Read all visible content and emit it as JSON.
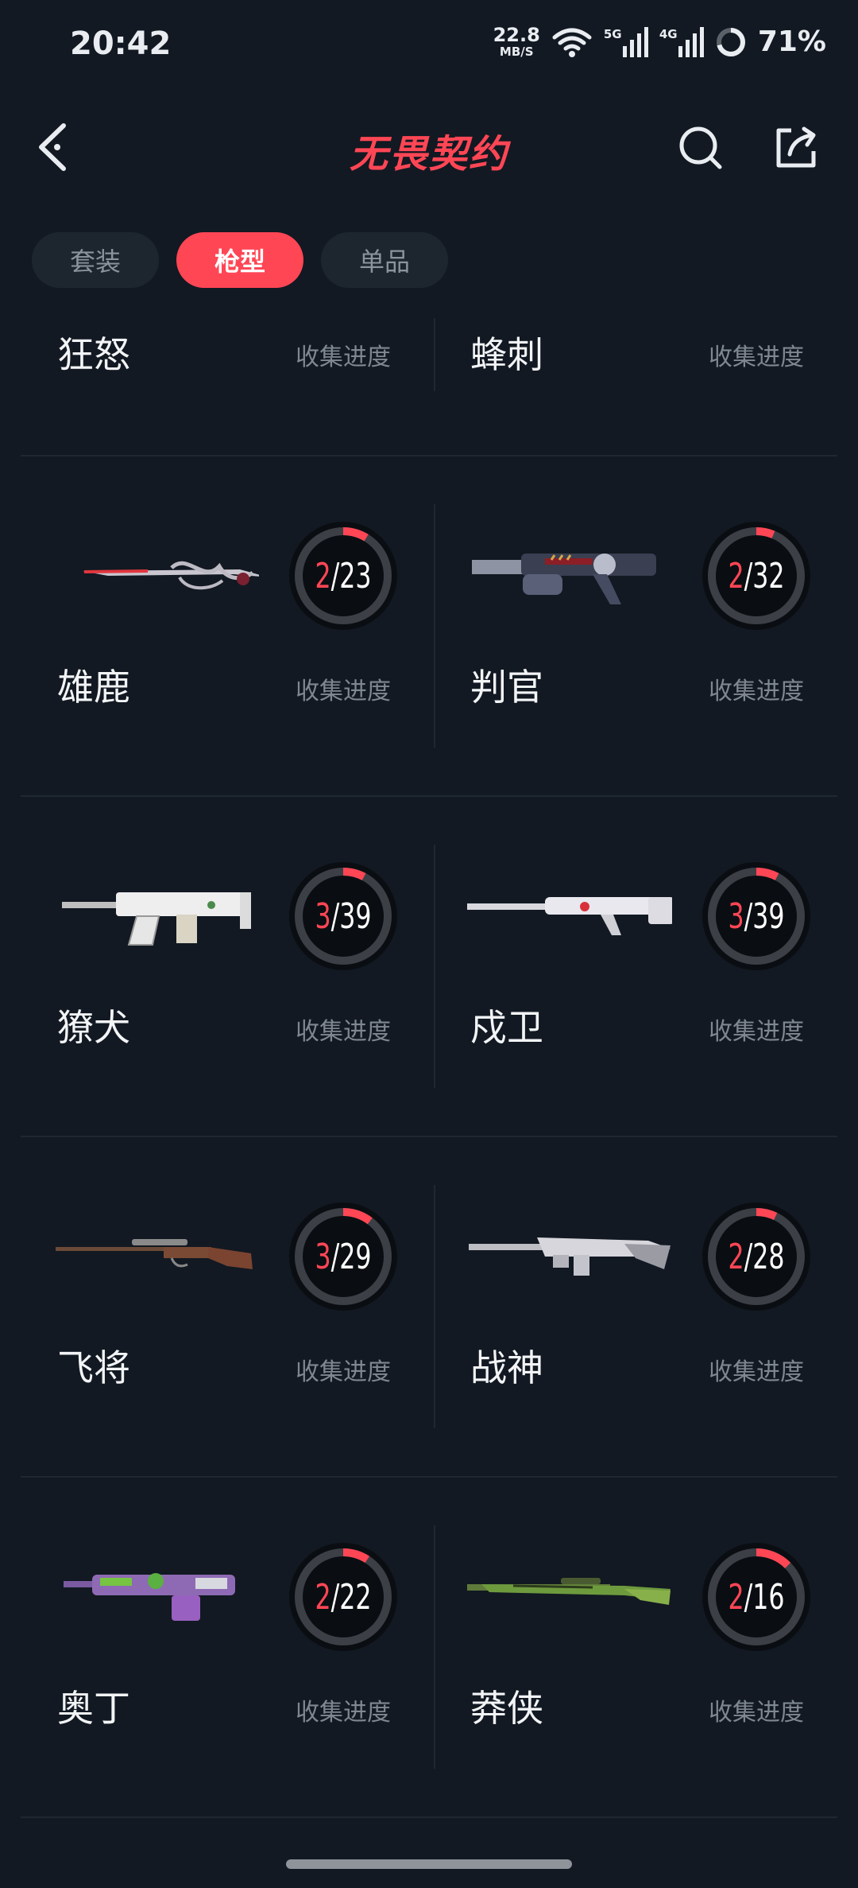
{
  "status_bar": {
    "time": "20:42",
    "net_speed_value": "22.8",
    "net_speed_unit": "MB/S",
    "sig1_tag": "5G",
    "sig2_tag": "4G",
    "battery": "71%"
  },
  "header": {
    "title": "无畏契约"
  },
  "tabs": [
    {
      "label": "套装",
      "active": false
    },
    {
      "label": "枪型",
      "active": true
    },
    {
      "label": "单品",
      "active": false
    }
  ],
  "progress_label": "收集进度",
  "partial_row": [
    {
      "name": "狂怒"
    },
    {
      "name": "蜂刺"
    }
  ],
  "rows": [
    [
      {
        "name": "雄鹿",
        "owned": "2",
        "total": "/23",
        "fraction": 0.087
      },
      {
        "name": "判官",
        "owned": "2",
        "total": "/32",
        "fraction": 0.0625
      }
    ],
    [
      {
        "name": "獠犬",
        "owned": "3",
        "total": "/39",
        "fraction": 0.077
      },
      {
        "name": "戍卫",
        "owned": "3",
        "total": "/39",
        "fraction": 0.077
      }
    ],
    [
      {
        "name": "飞将",
        "owned": "3",
        "total": "/29",
        "fraction": 0.103
      },
      {
        "name": "战神",
        "owned": "2",
        "total": "/28",
        "fraction": 0.071
      }
    ],
    [
      {
        "name": "奥丁",
        "owned": "2",
        "total": "/22",
        "fraction": 0.091
      },
      {
        "name": "莽侠",
        "owned": "2",
        "total": "/16",
        "fraction": 0.125
      }
    ]
  ],
  "colors": {
    "accent": "#ff4655",
    "background": "#121922",
    "tab_bg": "#1d252e"
  },
  "icons": [
    "back-icon",
    "search-icon",
    "share-icon",
    "wifi-icon",
    "battery-ring-icon"
  ]
}
